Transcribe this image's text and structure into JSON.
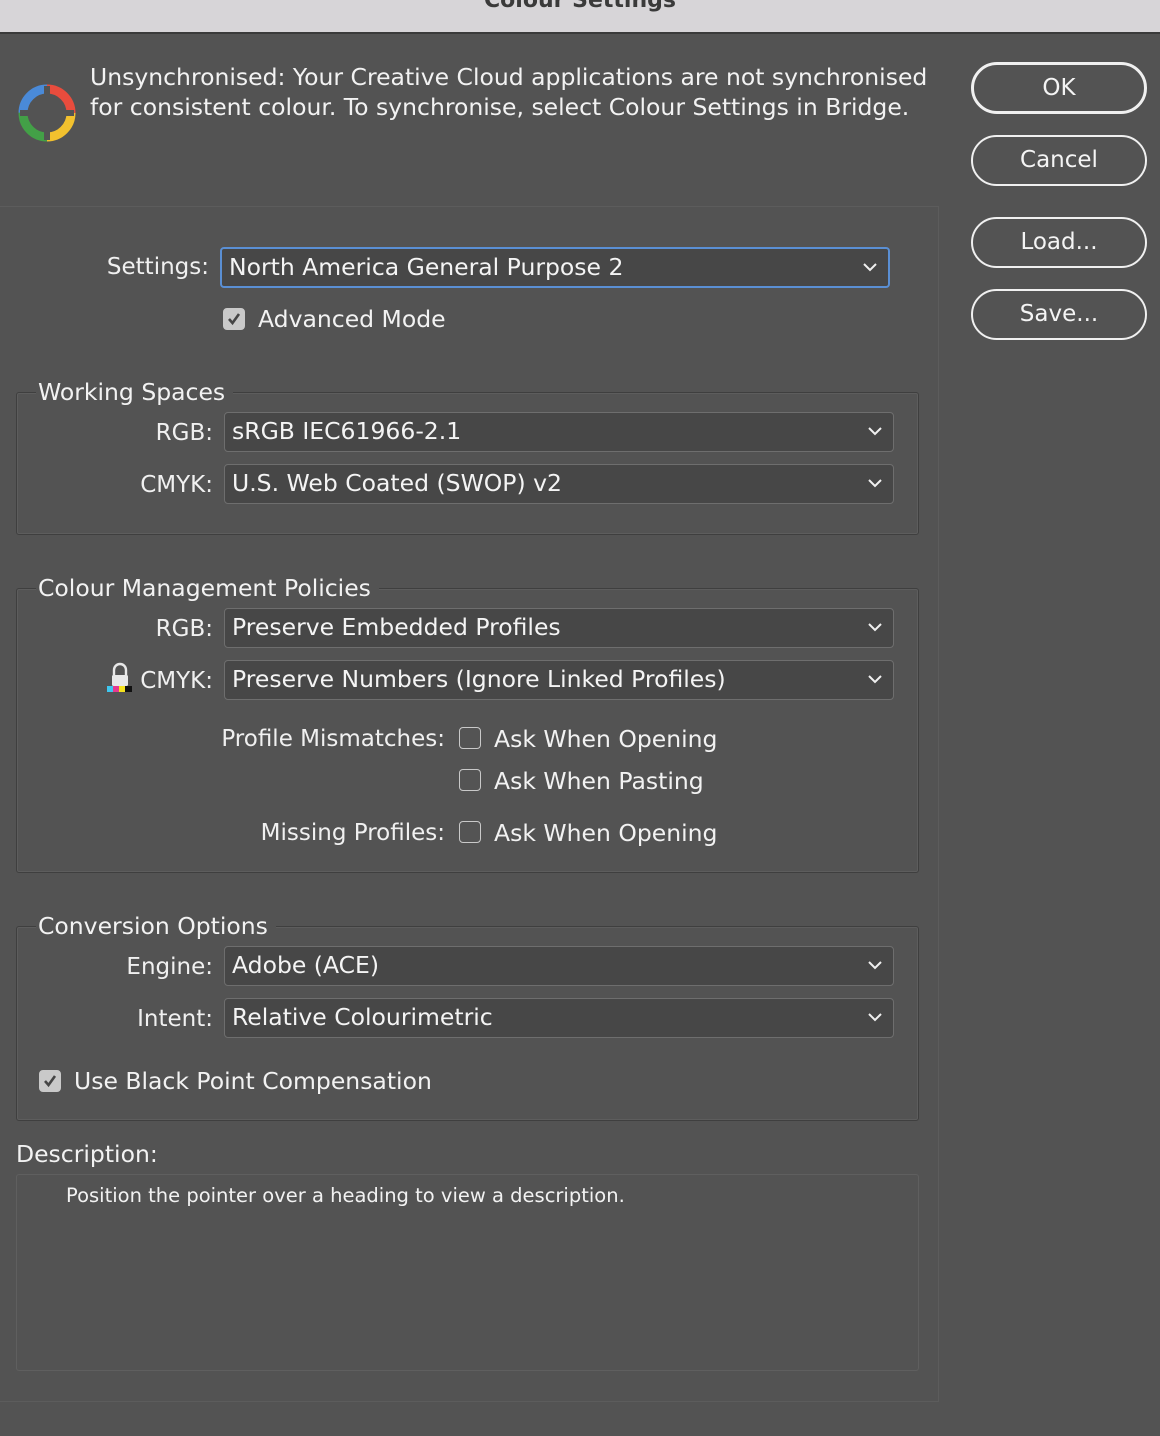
{
  "window": {
    "title": "Colour Settings"
  },
  "sync": {
    "icon": "colour-sync-icon",
    "message_line1": "Unsynchronised: Your Creative Cloud applications are not synchronised",
    "message_line2": "for consistent colour. To synchronise, select Colour Settings in Bridge."
  },
  "buttons": {
    "ok": "OK",
    "cancel": "Cancel",
    "load": "Load...",
    "save": "Save..."
  },
  "settings": {
    "label": "Settings:",
    "value": "North America General Purpose 2",
    "advanced_mode_label": "Advanced Mode",
    "advanced_mode_checked": true
  },
  "working_spaces": {
    "title": "Working Spaces",
    "rgb_label": "RGB:",
    "rgb_value": "sRGB IEC61966-2.1",
    "cmyk_label": "CMYK:",
    "cmyk_value": "U.S. Web Coated (SWOP) v2"
  },
  "policies": {
    "title": "Colour Management Policies",
    "rgb_label": "RGB:",
    "rgb_value": "Preserve Embedded Profiles",
    "cmyk_icon": "lock-icon",
    "cmyk_label": "CMYK:",
    "cmyk_value": "Preserve Numbers (Ignore Linked Profiles)",
    "profile_mismatches_label": "Profile Mismatches:",
    "ask_opening_label": "Ask When Opening",
    "ask_opening_checked": false,
    "ask_pasting_label": "Ask When Pasting",
    "ask_pasting_checked": false,
    "missing_profiles_label": "Missing Profiles:",
    "missing_ask_opening_label": "Ask When Opening",
    "missing_ask_opening_checked": false
  },
  "conversion": {
    "title": "Conversion Options",
    "engine_label": "Engine:",
    "engine_value": "Adobe (ACE)",
    "intent_label": "Intent:",
    "intent_value": "Relative Colourimetric",
    "bpc_label": "Use Black Point Compensation",
    "bpc_checked": true
  },
  "description": {
    "label": "Description:",
    "text": "Position the pointer over a heading to view a description."
  },
  "colors": {
    "background": "#535353",
    "dropdown_bg": "#474747",
    "focus_border": "#5a8fd4",
    "titlebar": "#d7d5d8"
  }
}
